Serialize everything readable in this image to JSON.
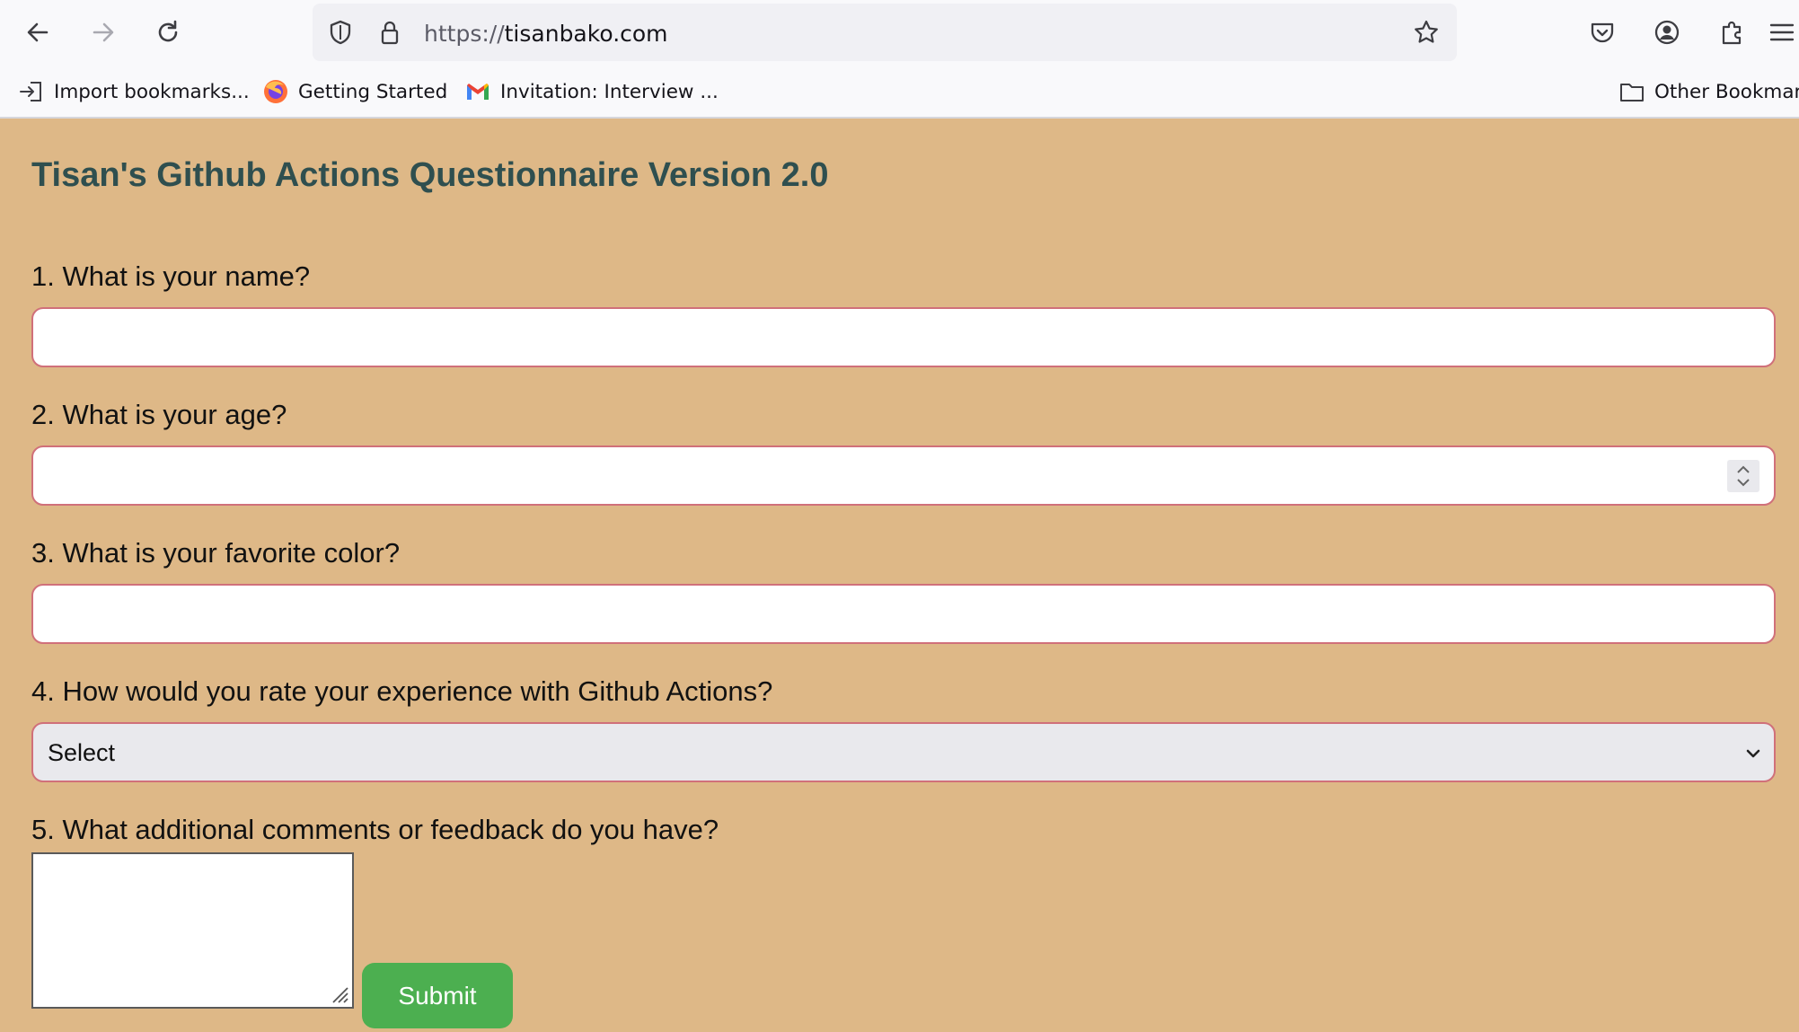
{
  "browser": {
    "url_scheme": "https://",
    "url_host": "tisanbako.com",
    "icons": [
      "back-icon",
      "forward-icon",
      "reload-icon",
      "shield-icon",
      "lock-icon",
      "bookmark-star-icon",
      "pocket-icon",
      "account-icon",
      "extensions-icon",
      "menu-icon"
    ]
  },
  "bookmarks": {
    "items": [
      {
        "label": "Import bookmarks...",
        "icon": "import-icon"
      },
      {
        "label": "Getting Started",
        "icon": "firefox-icon"
      },
      {
        "label": "Invitation: Interview ...",
        "icon": "gmail-icon"
      }
    ],
    "other_label": "Other Bookmarks"
  },
  "page": {
    "background": "#deb887",
    "title_color": "#2f4f4f",
    "title": "Tisan's Github Actions Questionnaire Version 2.0",
    "questions": [
      {
        "label": "1. What is your name?",
        "value": ""
      },
      {
        "label": "2. What is your age?",
        "value": ""
      },
      {
        "label": "3. What is your favorite color?",
        "value": ""
      },
      {
        "label": "4. How would you rate your experience with Github Actions?",
        "selected": "Select"
      },
      {
        "label": "5. What additional comments or feedback do you have?",
        "value": ""
      }
    ],
    "submit_label": "Submit",
    "submit_color": "#4caf50"
  }
}
